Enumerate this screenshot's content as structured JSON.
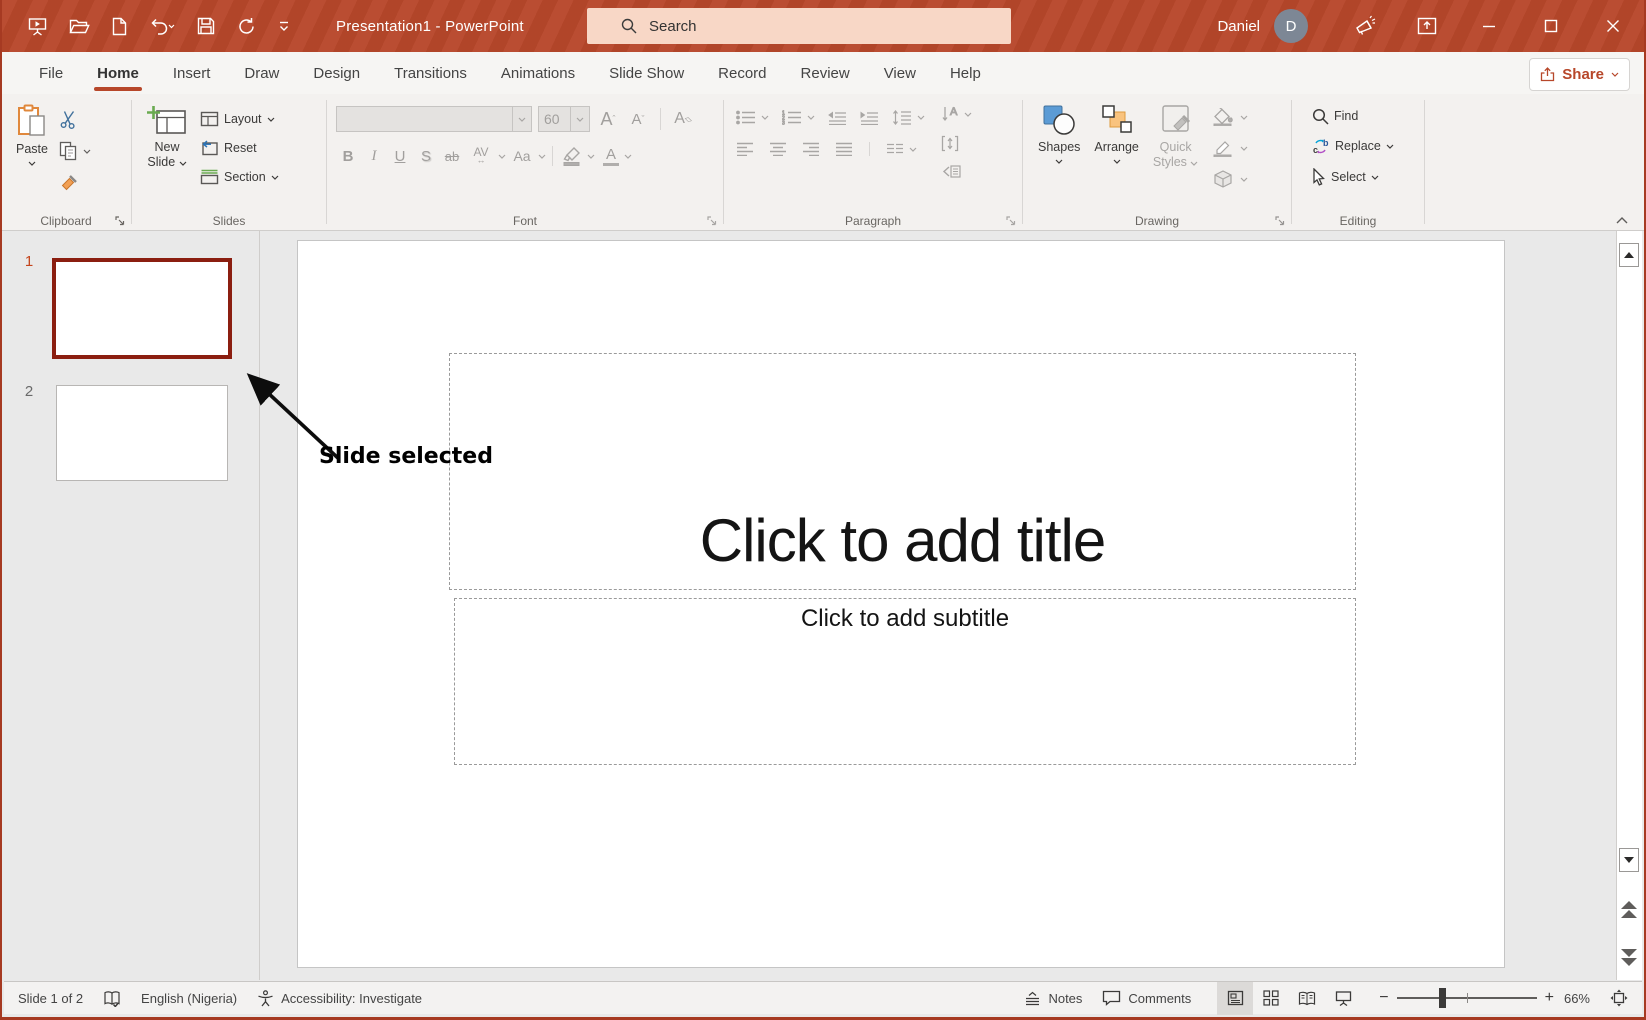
{
  "titlebar": {
    "title": "Presentation1  -  PowerPoint",
    "search_placeholder": "Search",
    "user_name": "Daniel",
    "user_initial": "D"
  },
  "tabs": [
    {
      "label": "File"
    },
    {
      "label": "Home"
    },
    {
      "label": "Insert"
    },
    {
      "label": "Draw"
    },
    {
      "label": "Design"
    },
    {
      "label": "Transitions"
    },
    {
      "label": "Animations"
    },
    {
      "label": "Slide Show"
    },
    {
      "label": "Record"
    },
    {
      "label": "Review"
    },
    {
      "label": "View"
    },
    {
      "label": "Help"
    }
  ],
  "share": {
    "label": "Share"
  },
  "ribbon": {
    "clipboard": {
      "label": "Clipboard",
      "paste": "Paste"
    },
    "slides": {
      "label": "Slides",
      "new_line1": "New",
      "new_line2": "Slide",
      "layout": "Layout",
      "reset": "Reset",
      "section": "Section"
    },
    "font": {
      "label": "Font",
      "size": "60",
      "grow": "A",
      "shrink": "A",
      "clear": "A",
      "bold": "B",
      "italic": "I",
      "underline": "U",
      "shadow": "S",
      "strike": "ab",
      "spacing": "AV",
      "case": "Aa",
      "color": "A"
    },
    "paragraph": {
      "label": "Paragraph"
    },
    "drawing": {
      "label": "Drawing",
      "shapes": "Shapes",
      "arrange": "Arrange",
      "quick1": "Quick",
      "quick2": "Styles"
    },
    "editing": {
      "label": "Editing",
      "find": "Find",
      "replace": "Replace",
      "select": "Select"
    }
  },
  "thumbnails": {
    "panel": [
      {
        "number": "1"
      },
      {
        "number": "2"
      }
    ]
  },
  "annotation": {
    "label": "Slide selected"
  },
  "slide": {
    "title": "Click to add title",
    "subtitle": "Click to add subtitle"
  },
  "statusbar": {
    "slide_indicator": "Slide 1 of 2",
    "language": "English (Nigeria)",
    "accessibility": "Accessibility: Investigate",
    "notes": "Notes",
    "comments": "Comments",
    "zoom": "66%"
  },
  "colors": {
    "accent": "#b7472a",
    "selected_thumb_border": "#8b1e10",
    "search_bg": "#f8d7c6"
  }
}
